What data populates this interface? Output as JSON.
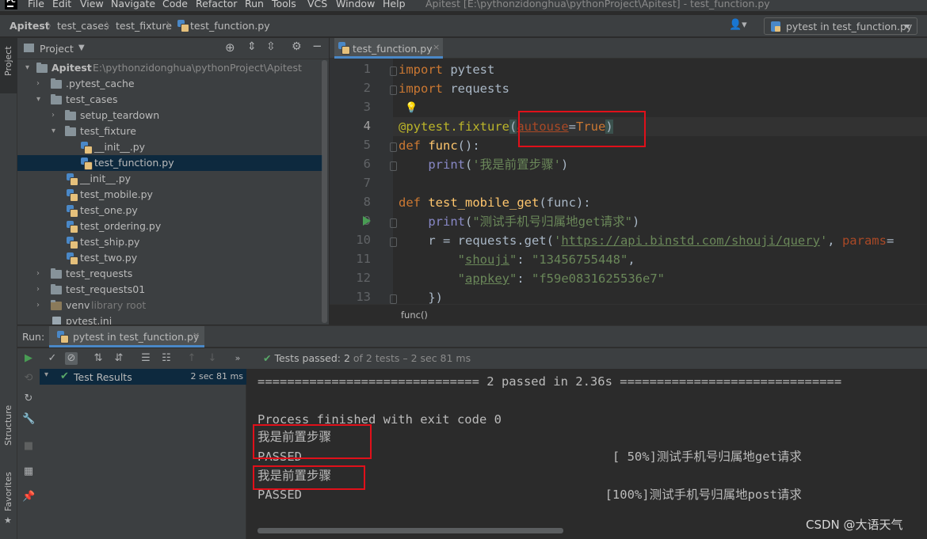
{
  "menubar": {
    "items": [
      "File",
      "Edit",
      "View",
      "Navigate",
      "Code",
      "Refactor",
      "Run",
      "Tools",
      "VCS",
      "Window",
      "Help"
    ],
    "window_title": "Apitest [E:\\pythonzidonghua\\pythonProject\\Apitest] - test_function.py"
  },
  "navbar": {
    "crumbs": [
      "Apitest",
      "test_cases",
      "test_fixture",
      "test_function.py"
    ],
    "run_config": "pytest in test_function.py"
  },
  "left_stripe": {
    "project": "Project",
    "structure": "Structure",
    "favorites": "Favorites"
  },
  "project": {
    "header": "Project",
    "root": {
      "name": "Apitest",
      "path": "E:\\pythonzidonghua\\pythonProject\\Apitest"
    },
    "items": [
      {
        "label": ".pytest_cache"
      },
      {
        "label": "test_cases"
      },
      {
        "label": "setup_teardown"
      },
      {
        "label": "test_fixture"
      },
      {
        "label": "__init__.py"
      },
      {
        "label": "test_function.py"
      },
      {
        "label": "__init__.py"
      },
      {
        "label": "test_mobile.py"
      },
      {
        "label": "test_one.py"
      },
      {
        "label": "test_ordering.py"
      },
      {
        "label": "test_ship.py"
      },
      {
        "label": "test_two.py"
      },
      {
        "label": "test_requests"
      },
      {
        "label": "test_requests01"
      },
      {
        "label": "venv",
        "note": "library root"
      },
      {
        "label": "pytest.ini"
      }
    ]
  },
  "editor": {
    "tab": "test_function.py",
    "line_numbers": [
      "1",
      "2",
      "3",
      "4",
      "5",
      "6",
      "7",
      "8",
      "9",
      "10",
      "11",
      "12",
      "13"
    ],
    "code": {
      "l1a": "import",
      "l1b": " pytest",
      "l2a": "import",
      "l2b": " requests",
      "l4a": "@pytest.fixture",
      "l4b": "(",
      "l4c": "autouse",
      "l4d": "=",
      "l4e": "True",
      "l4f": ")",
      "l5a": "def",
      "l5b": " func",
      "l5c": "():",
      "l6a": "    ",
      "l6b": "print",
      "l6c": "(",
      "l6d": "'我是前置步骤'",
      "l6e": ")",
      "l8a": "def",
      "l8b": " test_mobile_get",
      "l8c": "(func):",
      "l9a": "    ",
      "l9b": "print",
      "l9c": "(",
      "l9d": "\"测试手机号归属地get请求\"",
      "l9e": ")",
      "l10a": "    r = requests.get(",
      "l10b": "'",
      "l10c": "https://api.binstd.com/shouji/query",
      "l10d": "'",
      ", ": "",
      "l10e": ", ",
      "l10f": "params",
      "l10g": "=",
      "l11a": "        ",
      "l11b": "\"",
      "l11c": "shouji",
      "l11d": "\"",
      ":": "",
      "l11e": ": ",
      "l11f": "\"13456755448\"",
      "l11g": ",",
      "l12a": "        ",
      "l12b": "\"",
      "l12c": "appkey",
      "l12d": "\"",
      "l12e": ": ",
      "l12f": "\"f59e0831625536e7\"",
      "l13a": "    })"
    },
    "breadcrumb": "func()"
  },
  "run": {
    "label": "Run:",
    "tab": "pytest in test_function.py",
    "status_main": "Tests passed: 2",
    "status_rest": " of 2 tests – 2 sec 81 ms",
    "results_label": "Test Results",
    "results_time": "2 sec 81 ms",
    "console": [
      "============================== 2 passed in 2.36s ==============================",
      "Process finished with exit code 0",
      "我是前置步骤",
      "PASSED                                          [ 50%]测试手机号归属地get请求",
      "我是前置步骤",
      "PASSED                                         [100%]测试手机号归属地post请求"
    ]
  },
  "watermark": "CSDN @大语天气",
  "colors": {
    "accent": "#4a88c7",
    "highlight_box": "#e0101a",
    "pass_green": "#59a869"
  }
}
